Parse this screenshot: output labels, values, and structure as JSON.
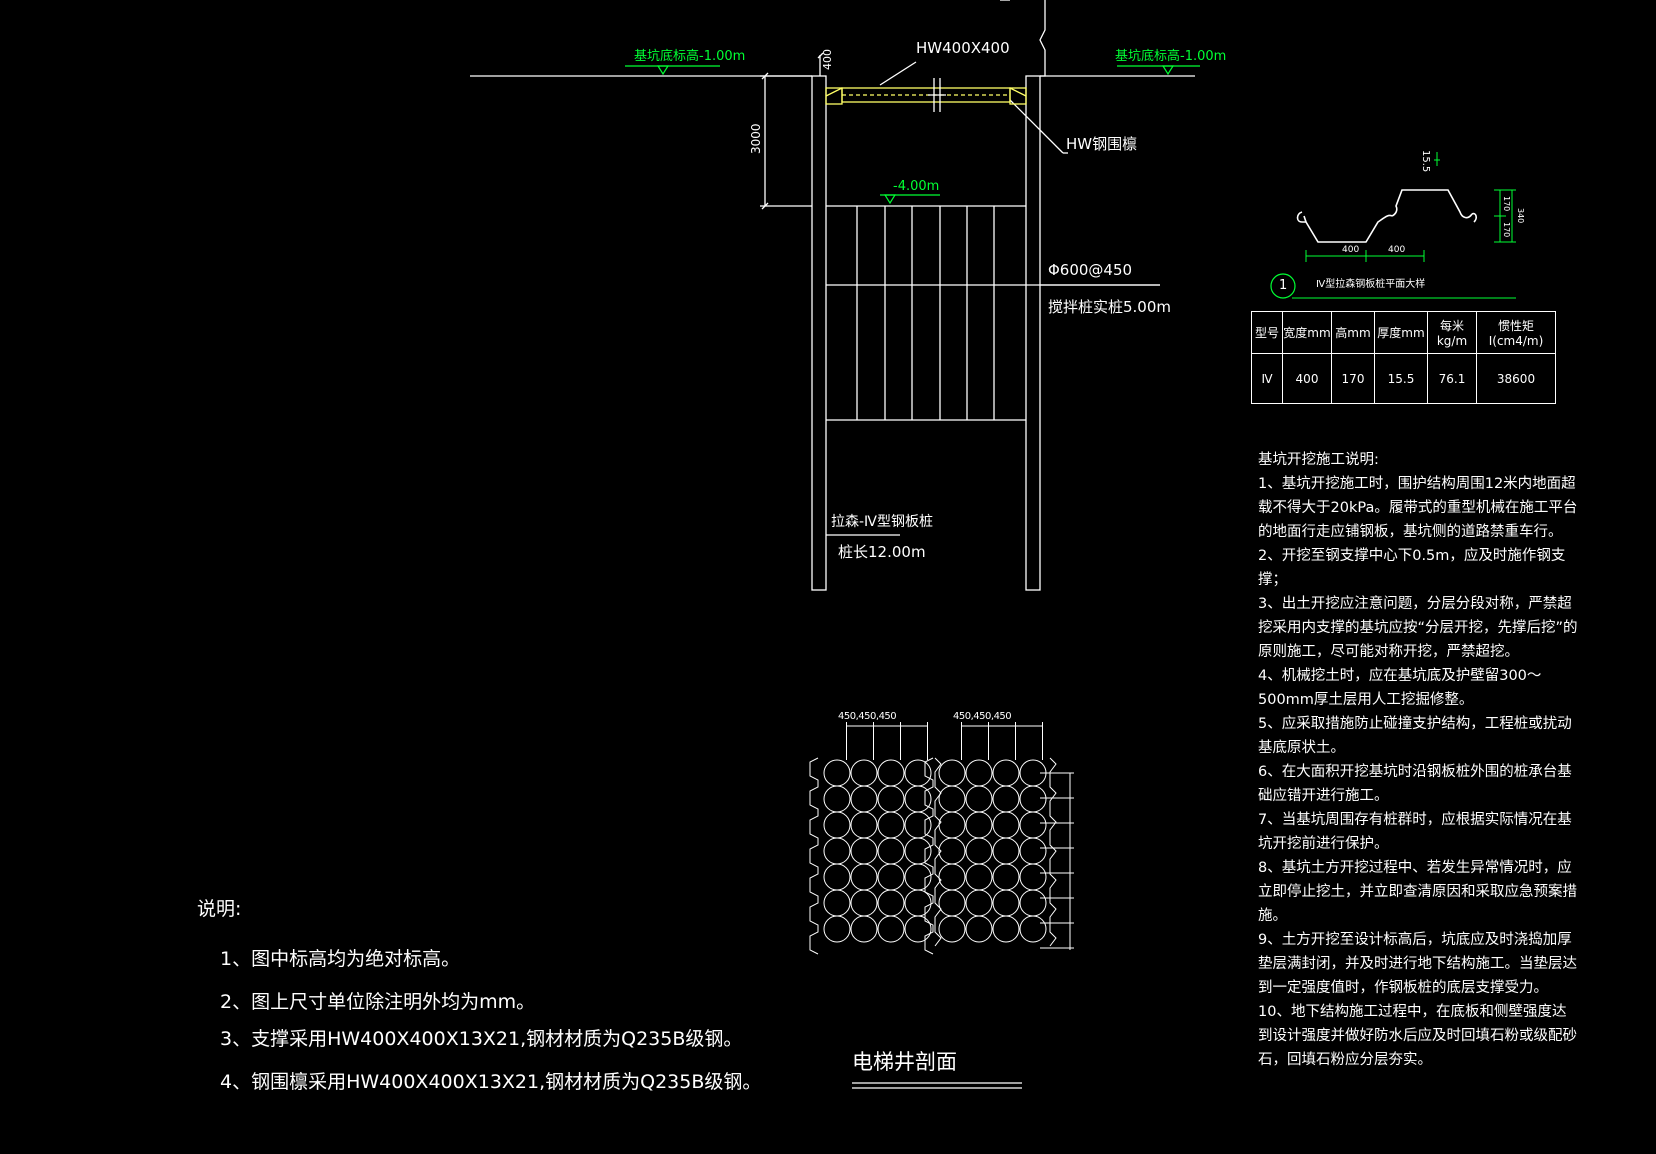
{
  "elevations": {
    "ground_left": "基坑底标高-1.00m",
    "ground_right": "基坑底标高-1.00m",
    "bottom": "-4.00m"
  },
  "dimensions": {
    "strut_depth": "400",
    "excavation_depth": "3000",
    "bore_pile_spacing": [
      "450",
      "450",
      "450"
    ]
  },
  "labels": {
    "strut": "HW400X400",
    "waling": "HW钢围檩",
    "mixing_pile_spec": "Φ600@450",
    "mixing_pile_length": "搅拌桩实桩5.00m",
    "sheet_pile_type": "拉森-Ⅳ型钢板桩",
    "sheet_pile_length": "桩长12.00m",
    "section_title": "电梯井剖面"
  },
  "sheet_detail": {
    "dim_left": "400",
    "dim_right": "400",
    "dim_top": "15.5",
    "dim_h1": "170",
    "dim_h2": "170",
    "dim_total": "340",
    "callout_number": "1",
    "callout_title": "Ⅳ型拉森钢板桩平面大样"
  },
  "property_table": {
    "headers": [
      "型号",
      "宽度mm",
      "高mm",
      "厚度mm",
      "每米kg/m",
      "惯性矩I(cm4/m)"
    ],
    "row": [
      "Ⅳ",
      "400",
      "170",
      "15.5",
      "76.1",
      "38600"
    ]
  },
  "construction_notes": {
    "title": "基坑开挖施工说明:",
    "items": [
      "1、基坑开挖施工时，围护结构周围12米内地面超载不得大于20kPa。履带式的重型机械在施工平台的地面行走应铺钢板，基坑侧的道路禁重车行。",
      "2、开挖至钢支撑中心下0.5m，应及时施作钢支撑；",
      "3、出土开挖应注意问题，分层分段对称，严禁超挖采用内支撑的基坑应按“分层开挖，先撑后挖”的原则施工，尽可能对称开挖，严禁超挖。",
      "4、机械挖土时，应在基坑底及护壁留300～500mm厚土层用人工挖掘修整。",
      "5、应采取措施防止碰撞支护结构，工程桩或扰动基底原状土。",
      "6、在大面积开挖基坑时沿钢板桩外围的桩承台基础应错开进行施工。",
      "7、当基坑周围存有桩群时，应根据实际情况在基坑开挖前进行保护。",
      "8、基坑土方开挖过程中、若发生异常情况时，应立即停止挖土，并立即查清原因和采取应急预案措施。",
      "9、土方开挖至设计标高后，坑底应及时浇捣加厚垫层满封闭，并及时进行地下结构施工。当垫层达到一定强度值时，作钢板桩的底层支撑受力。",
      "10、地下结构施工过程中，在底板和侧壁强度达到设计强度并做好防水后应及时回填石粉或级配砂石，回填石粉应分层夯实。"
    ]
  },
  "general_notes": {
    "title": "说明:",
    "items": [
      "1、图中标高均为绝对标高。",
      "2、图上尺寸单位除注明外均为mm。",
      "3、支撑采用HW400X400X13X21,钢材材质为Q235B级钢。",
      "4、钢围檩采用HW400X400X13X21,钢材材质为Q235B级钢。"
    ]
  },
  "colors": {
    "background": "#000000",
    "line": "#ffffff",
    "elevation_text": "#00ff33",
    "steel_member": "#ffff66"
  }
}
